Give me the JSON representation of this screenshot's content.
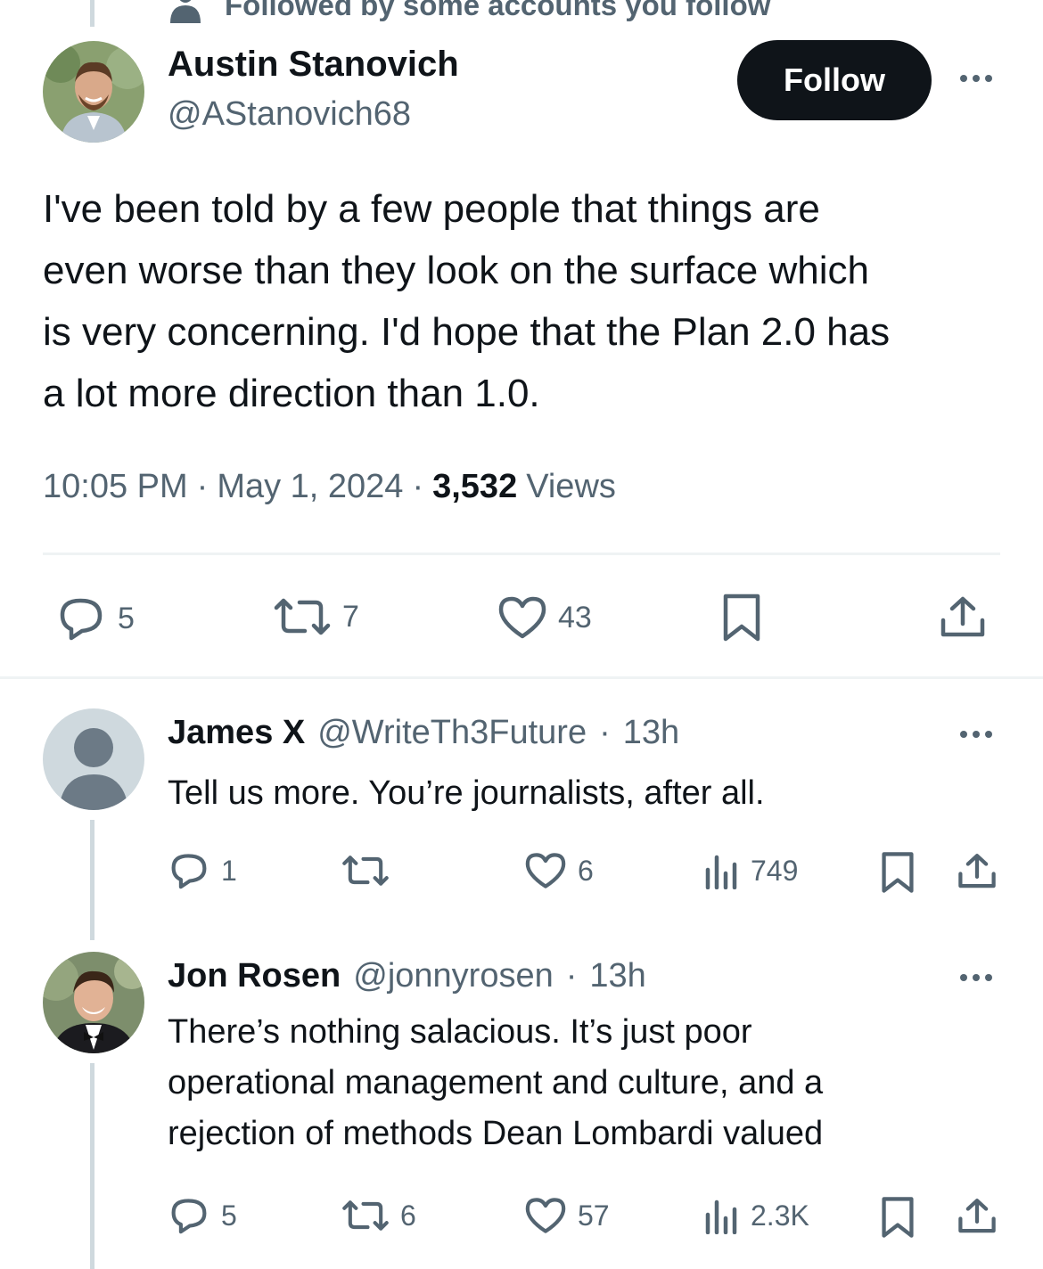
{
  "context": {
    "label": "Followed by some accounts you follow",
    "icon": "person-icon"
  },
  "main_tweet": {
    "author_name": "Austin Stanovich",
    "author_handle": "@AStanovich68",
    "follow_label": "Follow",
    "text_lines": [
      "I've been told by a few people that things are",
      "even worse than they look on the surface which",
      "is very concerning. I'd hope that the Plan 2.0 has",
      "a lot more direction than 1.0."
    ],
    "time": "10:05 PM",
    "date": "May 1, 2024",
    "separator": "·",
    "views_count": "3,532",
    "views_label": "Views",
    "replies": "5",
    "reposts": "7",
    "likes": "43"
  },
  "replies": [
    {
      "name": "James X",
      "handle": "@WriteTh3Future",
      "time": "13h",
      "text_lines": [
        "Tell us more. You’re journalists, after all."
      ],
      "replies": "1",
      "reposts": "",
      "likes": "6",
      "views": "749"
    },
    {
      "name": "Jon Rosen",
      "handle": "@jonnyrosen",
      "time": "13h",
      "text_lines": [
        "There’s nothing salacious. It’s just poor",
        "operational management and culture, and a",
        "rejection of methods Dean Lombardi valued"
      ],
      "replies": "5",
      "reposts": "6",
      "likes": "57",
      "views": "2.3K"
    }
  ],
  "colors": {
    "text": "#0f1419",
    "muted": "#536471",
    "divider": "#eff3f4",
    "thread": "#cfd9de"
  }
}
